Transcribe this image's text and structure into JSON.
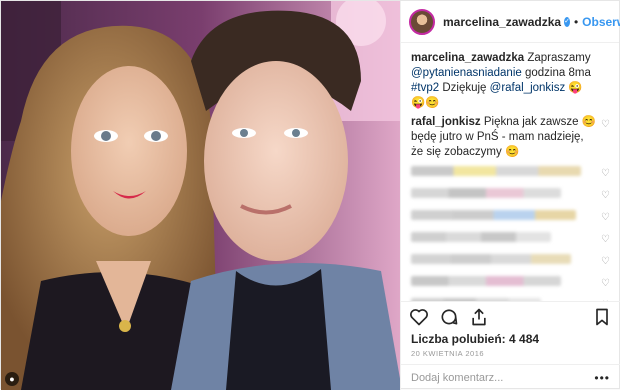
{
  "header": {
    "username": "marcelina_zawadzka",
    "dot": "•",
    "follow_label": "Obserwuj"
  },
  "caption": {
    "user": "marcelina_zawadzka",
    "text_1": " Zapraszamy ",
    "mention_1": "@pytanienasniadanie",
    "text_2": " godzina 8ma ",
    "hashtag": "#tvp2",
    "text_3": " Dziękuję ",
    "mention_2": "@rafal_jonkisz",
    "emoji": " 😜😜😊"
  },
  "comment": {
    "user": "rafal_jonkisz",
    "text": " Piękna jak zawsze 😊 będę jutro w PnŚ - mam nadzieję, że się zobaczymy 😊"
  },
  "blurred_comments": [
    {
      "colors": [
        "#c9c9c9",
        "#f2e6a0",
        "#d8d8d8",
        "#e8d9b0"
      ]
    },
    {
      "colors": [
        "#d6d6d6",
        "#c4c4c4",
        "#eac8d6",
        "#dcdcdc"
      ]
    },
    {
      "colors": [
        "#d0d0d0",
        "#cccccc",
        "#b9d2ee",
        "#e7d6a6"
      ]
    },
    {
      "colors": [
        "#cfcfcf",
        "#dadada",
        "#c8c8c8",
        "#e3e3e3"
      ]
    },
    {
      "colors": [
        "#d3d3d3",
        "#cdcdcd",
        "#d9d9d9",
        "#e8dcb8"
      ]
    },
    {
      "colors": [
        "#c7c7c7",
        "#d9d9d9",
        "#e4bdd2",
        "#d6d6d6"
      ]
    },
    {
      "colors": [
        "#d2d2d2",
        "#c9c9c9",
        "#dbdbdb",
        "#e6e6e6"
      ]
    }
  ],
  "actions": {
    "likes_label": "Liczba polubień:",
    "likes_count": "4 484",
    "date": "20 KWIETNIA 2016",
    "add_comment_placeholder": "Dodaj komentarz...",
    "more": "•••"
  },
  "icons": [
    "heart-icon",
    "comment-icon",
    "share-icon",
    "bookmark-icon",
    "verified-icon",
    "camera-icon"
  ],
  "colors": {
    "link": "#3897f0",
    "mention": "#003569",
    "verified": "#3897f0",
    "text": "#262626",
    "muted": "#999999"
  }
}
